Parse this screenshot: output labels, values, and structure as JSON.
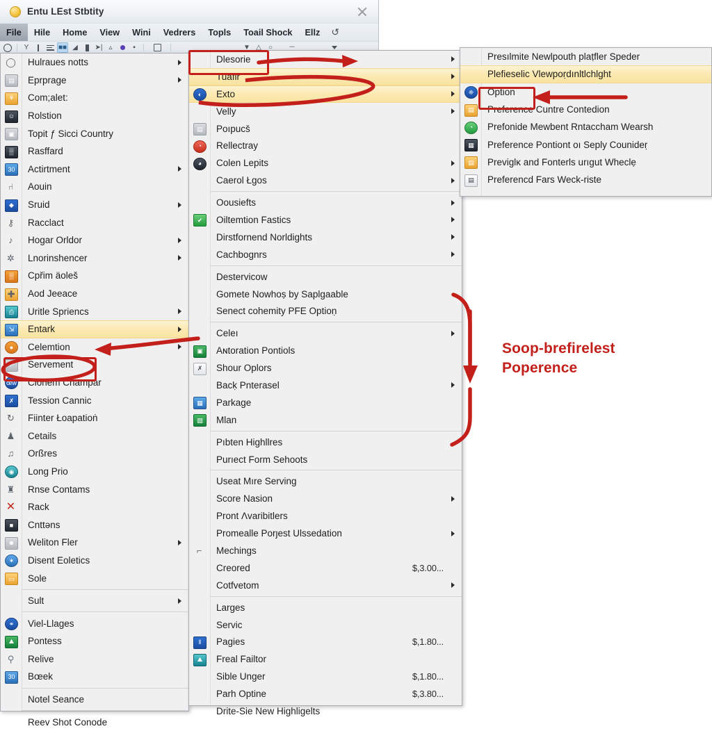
{
  "window": {
    "title": "Entu LEst Stbtity",
    "close_label": "×",
    "menubar": [
      {
        "label": "File",
        "active": true
      },
      {
        "label": "Hile",
        "active": false
      },
      {
        "label": "Home",
        "active": false
      },
      {
        "label": "View",
        "active": false
      },
      {
        "label": "Wini",
        "active": false
      },
      {
        "label": "Vedrers",
        "active": false
      },
      {
        "label": "Topls",
        "active": false
      },
      {
        "label": "Toail Shock",
        "active": false
      },
      {
        "label": "Ellz",
        "active": false
      },
      {
        "label": "↺",
        "active": false,
        "glyph": true
      }
    ]
  },
  "left_menu": {
    "items": [
      {
        "label": "Hulraues notts",
        "icon": "speech-bubble-icon",
        "icon_style": "plain",
        "glyph": "◯",
        "submenu": true
      },
      {
        "label": "Eprprage",
        "icon": "card-icon",
        "icon_style": "grey",
        "glyph": "▤",
        "submenu": true
      },
      {
        "label": "Com;alet:",
        "icon": "people-icon",
        "icon_style": "orange",
        "glyph": "⚘",
        "submenu": false
      },
      {
        "label": "Rolstion",
        "icon": "contact-icon",
        "icon_style": "dark",
        "glyph": "☺",
        "submenu": false
      },
      {
        "label": "Topit ƒ Sicci Country",
        "icon": "monitor-icon",
        "icon_style": "grey",
        "glyph": "▣",
        "submenu": false
      },
      {
        "label": "Rasffard",
        "icon": "grid-icon",
        "icon_style": "dark",
        "glyph": "▒",
        "submenu": false
      },
      {
        "label": "Actirtment",
        "icon": "calendar-icon",
        "icon_style": "blue",
        "glyph": "30",
        "submenu": true
      },
      {
        "label": "Aouin",
        "icon": "faucet-icon",
        "icon_style": "plain",
        "glyph": "⑁",
        "submenu": false
      },
      {
        "label": "Sruid",
        "icon": "diamond-icon",
        "icon_style": "dblue",
        "glyph": "◆",
        "submenu": true
      },
      {
        "label": "Racclact",
        "icon": "lock-icon",
        "icon_style": "plain",
        "glyph": "⚷",
        "submenu": false
      },
      {
        "label": "Hogar Orldor",
        "icon": "note-icon",
        "icon_style": "plain",
        "glyph": "♪",
        "submenu": true
      },
      {
        "label": "Lnorinshencer",
        "icon": "globe-icon",
        "icon_style": "plain",
        "glyph": "✲",
        "submenu": true
      },
      {
        "label": "Cpřim äoleš",
        "icon": "building-icon",
        "icon_style": "dorange",
        "glyph": "▒",
        "submenu": false
      },
      {
        "label": "Aod Jeeace",
        "icon": "add-page-icon",
        "icon_style": "orange",
        "glyph": "➕",
        "submenu": false
      },
      {
        "label": "Uritle Spriencs",
        "icon": "printer-icon",
        "icon_style": "teal",
        "glyph": "⎙",
        "submenu": true
      },
      {
        "label": "Entark",
        "icon": "export-icon",
        "icon_style": "blue",
        "glyph": "⇲",
        "submenu": true,
        "highlight": true
      },
      {
        "label": "Celemtion",
        "icon": "ball-icon",
        "icon_style": "dorange",
        "glyph": "●",
        "submenu": true,
        "circle": true
      },
      {
        "label": "Servement",
        "icon": "chart-icon",
        "icon_style": "grey",
        "glyph": "↗",
        "submenu": false
      },
      {
        "label": "Clònem Champar",
        "icon": "badge-icon",
        "icon_style": "dblue",
        "glyph": "œŵ",
        "submenu": false,
        "circle": true
      },
      {
        "label": "Tession Cannic",
        "icon": "excel-icon",
        "icon_style": "dblue",
        "glyph": "✗",
        "submenu": false
      },
      {
        "label": "Fiinter Łoapatioṅ",
        "icon": "refresh-icon",
        "icon_style": "plain",
        "glyph": "↻",
        "submenu": false
      },
      {
        "label": "Cetails",
        "icon": "person-icon",
        "icon_style": "plain",
        "glyph": "♟",
        "submenu": false
      },
      {
        "label": "Orßres",
        "icon": "music-icon",
        "icon_style": "plain",
        "glyph": "♫",
        "submenu": false
      },
      {
        "label": "Long Prio",
        "icon": "disc-icon",
        "icon_style": "teal",
        "glyph": "◉",
        "submenu": false,
        "circle": true
      },
      {
        "label": "Rnse Contams",
        "icon": "tower-icon",
        "icon_style": "plain",
        "glyph": "♜",
        "submenu": false
      },
      {
        "label": "Rack",
        "icon": "delete-icon",
        "icon_style": "xmark",
        "glyph": "✕",
        "submenu": false
      },
      {
        "label": "Cnttəns",
        "icon": "screen-icon",
        "icon_style": "dark",
        "glyph": "■",
        "submenu": false
      },
      {
        "label": "Weliton Fler",
        "icon": "user-card-icon",
        "icon_style": "grey",
        "glyph": "☻",
        "submenu": true
      },
      {
        "label": "Disent Eoletics",
        "icon": "network-icon",
        "icon_style": "blue",
        "glyph": "✶",
        "submenu": false,
        "circle": true
      },
      {
        "label": "Sole",
        "icon": "page-icon",
        "icon_style": "orange",
        "glyph": "▭",
        "submenu": false
      },
      {
        "sep": true
      },
      {
        "label": "Sult",
        "icon": "none",
        "icon_style": "none",
        "glyph": "",
        "submenu": true
      },
      {
        "sep": true
      },
      {
        "label": "Viel-Llages",
        "icon": "link-icon",
        "icon_style": "dblue",
        "glyph": "⚭",
        "submenu": false,
        "circle": true
      },
      {
        "label": "Pontess",
        "icon": "image-icon",
        "icon_style": "dgreen",
        "glyph": "⛰",
        "submenu": false
      },
      {
        "label": "Relive",
        "icon": "search-icon",
        "icon_style": "search",
        "glyph": "⚲",
        "submenu": false
      },
      {
        "label": "Bœek",
        "icon": "calendar-blue-icon",
        "icon_style": "blue",
        "glyph": "30",
        "submenu": false
      },
      {
        "sep": true
      },
      {
        "label": "Notel Seance",
        "icon": "none",
        "icon_style": "none",
        "glyph": "",
        "submenu": false
      },
      {
        "sep": true
      },
      {
        "label": "Reev Shot Conode",
        "icon": "none",
        "icon_style": "none",
        "glyph": "",
        "submenu": false
      }
    ]
  },
  "mid_menu": {
    "items": [
      {
        "label": "Dlesorie",
        "icon": "none",
        "icon_style": "none",
        "glyph": "",
        "submenu": true
      },
      {
        "label": "Tuafir",
        "icon": "none",
        "icon_style": "none",
        "glyph": "",
        "submenu": true,
        "highlight": true
      },
      {
        "label": "Exto",
        "icon": "firefox-icon",
        "icon_style": "dblue",
        "glyph": "◐",
        "submenu": true,
        "highlight": true,
        "circle": true
      },
      {
        "label": "Velly",
        "icon": "none",
        "icon_style": "none",
        "glyph": "",
        "submenu": true
      },
      {
        "label": "Poıpucš",
        "icon": "doc-lock-icon",
        "icon_style": "grey",
        "glyph": "▤",
        "submenu": false
      },
      {
        "label": "Rellectray",
        "icon": "browser-icon",
        "icon_style": "red",
        "glyph": "◔",
        "submenu": false,
        "circle": true
      },
      {
        "label": "Colen Lepits",
        "icon": "opera-icon",
        "icon_style": "dark",
        "glyph": "◕",
        "submenu": true,
        "circle": true
      },
      {
        "label": "Caerol Łgos",
        "icon": "none",
        "icon_style": "none",
        "glyph": "",
        "submenu": true
      },
      {
        "sep": true
      },
      {
        "label": "Oousiefts",
        "icon": "none",
        "icon_style": "none",
        "glyph": "",
        "submenu": true
      },
      {
        "label": "Oiltemtion Fastics",
        "icon": "excel-green-icon",
        "icon_style": "green",
        "glyph": "✔",
        "submenu": true
      },
      {
        "label": "Dirstfornend Norldights",
        "icon": "none",
        "icon_style": "none",
        "glyph": "",
        "submenu": true
      },
      {
        "label": "Cachbognrs",
        "icon": "none",
        "icon_style": "none",
        "glyph": "",
        "submenu": true
      },
      {
        "sep": true
      },
      {
        "label": "Destеrvicow",
        "icon": "none",
        "icon_style": "none",
        "glyph": "",
        "submenu": false
      },
      {
        "label": "Gomete Nowhoṣ by Saplgaable",
        "icon": "none",
        "icon_style": "none",
        "glyph": "",
        "submenu": false
      },
      {
        "label": "Senect cohemity PFE Optioṇ",
        "icon": "none",
        "icon_style": "none",
        "glyph": "",
        "submenu": false
      },
      {
        "sep": true
      },
      {
        "label": "Celeı",
        "icon": "none",
        "icon_style": "none",
        "glyph": "",
        "submenu": true
      },
      {
        "label": "Aɴtoration Pontiols",
        "icon": "picture-icon",
        "icon_style": "dgreen",
        "glyph": "▣",
        "submenu": false
      },
      {
        "label": "Shour Oplors",
        "icon": "chart-x-icon",
        "icon_style": "white",
        "glyph": "✗",
        "submenu": false
      },
      {
        "label": "Bacḳ Pnterasel",
        "icon": "none",
        "icon_style": "none",
        "glyph": "",
        "submenu": true
      },
      {
        "label": "Parkage",
        "icon": "table-icon",
        "icon_style": "blue",
        "glyph": "▦",
        "submenu": false
      },
      {
        "label": "Mlan",
        "icon": "excel-doc-icon",
        "icon_style": "dgreen",
        "glyph": "▧",
        "submenu": false
      },
      {
        "sep": true
      },
      {
        "label": "Pıbten Highllres",
        "icon": "none",
        "icon_style": "none",
        "glyph": "",
        "submenu": false
      },
      {
        "label": "Purıect Form Sehoots",
        "icon": "none",
        "icon_style": "none",
        "glyph": "",
        "submenu": false
      },
      {
        "sep": true
      },
      {
        "label": "Useat Mıre Serving",
        "icon": "none",
        "icon_style": "none",
        "glyph": "",
        "submenu": false
      },
      {
        "label": "Score Nasion",
        "icon": "none",
        "icon_style": "none",
        "glyph": "",
        "submenu": true
      },
      {
        "label": "Pront Λvaribitlers",
        "icon": "none",
        "icon_style": "none",
        "glyph": "",
        "submenu": false
      },
      {
        "label": "Promealle Porȷest Ulssedation",
        "icon": "none",
        "icon_style": "none",
        "glyph": "",
        "submenu": true
      },
      {
        "label": "Mechings",
        "icon": "bracket-icon",
        "icon_style": "plain",
        "glyph": "⌐",
        "submenu": false
      },
      {
        "label": "Creored",
        "icon": "none",
        "icon_style": "none",
        "glyph": "",
        "submenu": false,
        "price": "$,3.00..."
      },
      {
        "label": "Cotfvetom",
        "icon": "none",
        "icon_style": "none",
        "glyph": "",
        "submenu": true
      },
      {
        "sep": true
      },
      {
        "label": "Larges",
        "icon": "none",
        "icon_style": "none",
        "glyph": "",
        "submenu": false
      },
      {
        "label": "Servic",
        "icon": "none",
        "icon_style": "none",
        "glyph": "",
        "submenu": false
      },
      {
        "label": "Pagies",
        "icon": "barcode-icon",
        "icon_style": "dblue",
        "glyph": "‖",
        "submenu": false,
        "price": "$,1.80..."
      },
      {
        "label": "Freal Failtor",
        "icon": "photo-icon",
        "icon_style": "teal",
        "glyph": "⛰",
        "submenu": false
      },
      {
        "label": "Sible Unger",
        "icon": "none",
        "icon_style": "none",
        "glyph": "",
        "submenu": false,
        "price": "$,1.80..."
      },
      {
        "label": "Parh Optine",
        "icon": "none",
        "icon_style": "none",
        "glyph": "",
        "submenu": false,
        "price": "$,3.80..."
      },
      {
        "label": "Drite-Sie New Highligelts",
        "icon": "none",
        "icon_style": "none",
        "glyph": "",
        "submenu": false
      }
    ]
  },
  "right_menu": {
    "items": [
      {
        "label": "Presılmite Newlpouth plaṭfler Speder",
        "icon": "none",
        "icon_style": "none",
        "glyph": "",
        "submenu": false
      },
      {
        "label": "Plefieselic Vlewpoṛdınltlchlght",
        "icon": "none",
        "icon_style": "none",
        "glyph": "",
        "submenu": false,
        "highlight": true
      },
      {
        "label": "Option",
        "icon": "globe-app-icon",
        "icon_style": "dblue",
        "glyph": "❈",
        "submenu": false,
        "circle": true
      },
      {
        "label": "Preference Cuntre Contedion",
        "icon": "window-icon",
        "icon_style": "orange",
        "glyph": "▤",
        "submenu": false
      },
      {
        "label": "Prefonide Mewbent Rntaccham Wearsh",
        "icon": "clock-green-icon",
        "icon_style": "green",
        "glyph": "◔",
        "submenu": false,
        "circle": true
      },
      {
        "label": "Preference Pontiont oı Seply Counideṛ",
        "icon": "device-icon",
        "icon_style": "dark",
        "glyph": "▦",
        "submenu": false
      },
      {
        "label": "Previglĸ and Fonterls urıgut Wheclẹ",
        "icon": "window-orange-icon",
        "icon_style": "orange",
        "glyph": "▤",
        "submenu": false
      },
      {
        "label": "Preferencd Fars Weck-riste",
        "icon": "clipboard-icon",
        "icon_style": "white",
        "glyph": "▤",
        "submenu": false
      }
    ]
  },
  "annotations": {
    "callout_text_line1": "Soop-brefirelest",
    "callout_text_line2": "Poperence",
    "accent_color": "#c4201b",
    "highlight_color": "#fbe9b0",
    "boxes": [
      {
        "name": "dlesorie-highlight-box"
      },
      {
        "name": "servement-highlight-box"
      },
      {
        "name": "option-highlight-box"
      }
    ]
  }
}
